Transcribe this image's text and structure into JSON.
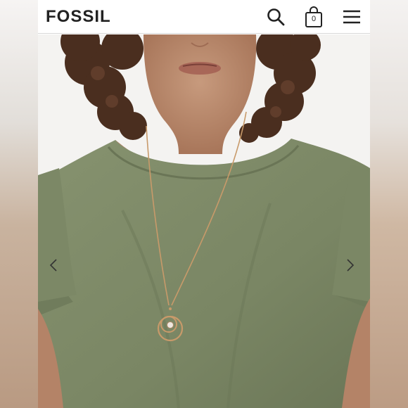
{
  "header": {
    "logo_text": "FOSSIL",
    "bag_count": "0",
    "icons": [
      "search-icon",
      "shopping-bag-icon",
      "hamburger-menu-icon"
    ]
  },
  "carousel": {
    "prev_icon": "chevron-left-icon",
    "next_icon": "chevron-right-icon"
  },
  "colors": {
    "brand_text": "#222222",
    "shirt_olive": "#7d8a68",
    "chain_gold": "#c89a6a"
  }
}
